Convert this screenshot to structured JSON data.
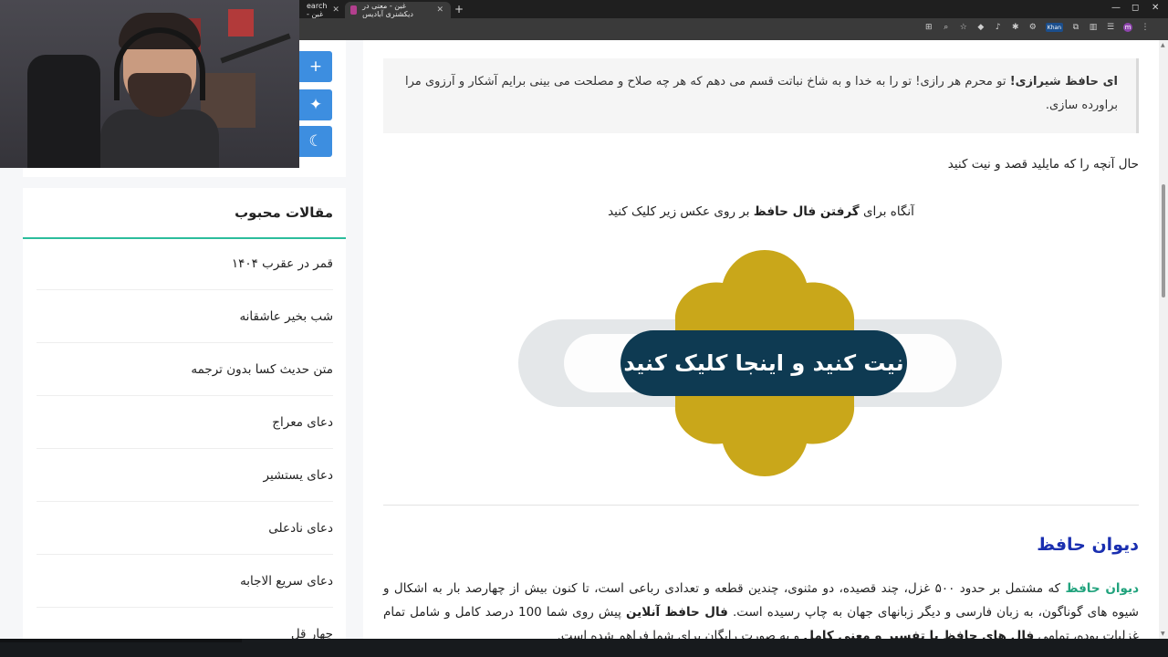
{
  "browser": {
    "tabs": [
      {
        "label": "earch - غبن",
        "active": false
      },
      {
        "label": "غبن - معنی در دیکشنری آبادیس",
        "active": true
      }
    ],
    "new_tab": "+",
    "window_controls": [
      "—",
      "◻",
      "✕"
    ],
    "extension_badge": "Khan",
    "profile_initial": "m"
  },
  "floating_buttons": [
    "+",
    "✦",
    "☾"
  ],
  "sidebar": {
    "title": "مقالات محبوب",
    "items": [
      "قمر در عقرب ۱۴۰۴",
      "شب بخیر عاشقانه",
      "متن حدیث کسا بدون ترجمه",
      "دعای معراج",
      "دعای یستشیر",
      "دعای نادعلی",
      "دعای سریع الاجابه",
      "چهار قل"
    ]
  },
  "content": {
    "quote_bold": "ای حافظ شیرازی!",
    "quote_text": " تو محرم هر رازی! تو را به خدا و به شاخ نباتت قسم می دهم که هر چه صلاح و مصلحت می بینی برایم آشکار و آرزوی مرا براورده سازی.",
    "para1": "حال آنچه را که مایلید قصد و نیت کنید",
    "para2_pre": "آنگاه برای ",
    "para2_bold": "گرفتن فال حافظ",
    "para2_post": " بر روی عکس زیر کلیک کنید",
    "banner_label": "نیت کنید و اینجا کلیک کنید",
    "heading": "دیوان حافظ",
    "para3_link": "دیوان حافظ",
    "para3_a": " که مشتمل بر حدود ۵۰۰ غزل، چند قصیده، دو مثنوی، چندین قطعه و تعدادی رباعی است، تا کنون بیش از چهارصد بار به اشکال و شیوه های گوناگون، به زبان فارسی و دیگر زبانهای جهان به چاپ رسیده است. ",
    "para3_bold1": "فال حافظ آنلاین",
    "para3_b": " پیش روی شما 100 درصد کامل و شامل تمام غزلیات بوده، تمامی ",
    "para3_bold2": "فال های حافظ با تفسیر و معنی کامل",
    "para3_c": " و به صورت رایگان برای شما فراهم شده است."
  },
  "colors": {
    "accent_green": "#2bbd9c",
    "button_blue": "#3d8ee0",
    "heading_blue": "#1a2fb0",
    "banner_navy": "#0e3a52",
    "banner_gold": "#c9a71a"
  }
}
